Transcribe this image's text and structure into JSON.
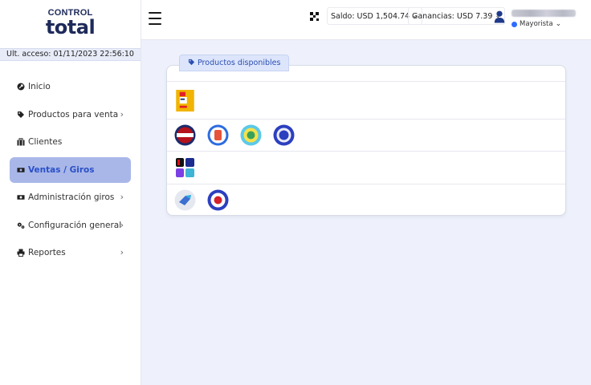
{
  "logo": {
    "line1": "CONTROL",
    "line2": "total"
  },
  "last_access": "Ult. acceso: 01/11/2023 22:56:10",
  "sidebar": {
    "items": [
      {
        "label": "Inicio",
        "icon": "rocket-icon",
        "has_chevron": false,
        "active": false
      },
      {
        "label": "Productos para venta",
        "icon": "tag-icon",
        "has_chevron": true,
        "active": false
      },
      {
        "label": "Clientes",
        "icon": "briefcase-icon",
        "has_chevron": false,
        "active": false
      },
      {
        "label": "Ventas / Giros",
        "icon": "money-icon",
        "has_chevron": false,
        "active": true
      },
      {
        "label": "Administración giros",
        "icon": "money-icon",
        "has_chevron": true,
        "active": false
      },
      {
        "label": "Configuración general",
        "icon": "gears-icon",
        "has_chevron": true,
        "active": false
      },
      {
        "label": "Reportes",
        "icon": "print-icon",
        "has_chevron": true,
        "active": false
      }
    ]
  },
  "topbar": {
    "saldo": "Saldo: USD 1,504.74",
    "ganancias": "Ganancias: USD 7.39",
    "role": "Mayorista"
  },
  "main": {
    "tab_label": "Productos disponibles",
    "rows": [
      {
        "products": [
          "product-icon-1"
        ]
      },
      {
        "products": [
          "product-icon-2",
          "product-icon-3",
          "product-icon-4",
          "product-icon-5"
        ]
      },
      {
        "products": [
          "product-icon-6"
        ]
      },
      {
        "products": [
          "product-icon-7",
          "product-icon-8"
        ]
      }
    ]
  },
  "colors": {
    "accent": "#2f6bff",
    "active_bg": "#a9b7e8",
    "active_text": "#2a4fc8",
    "page_bg": "#eef1fb"
  }
}
